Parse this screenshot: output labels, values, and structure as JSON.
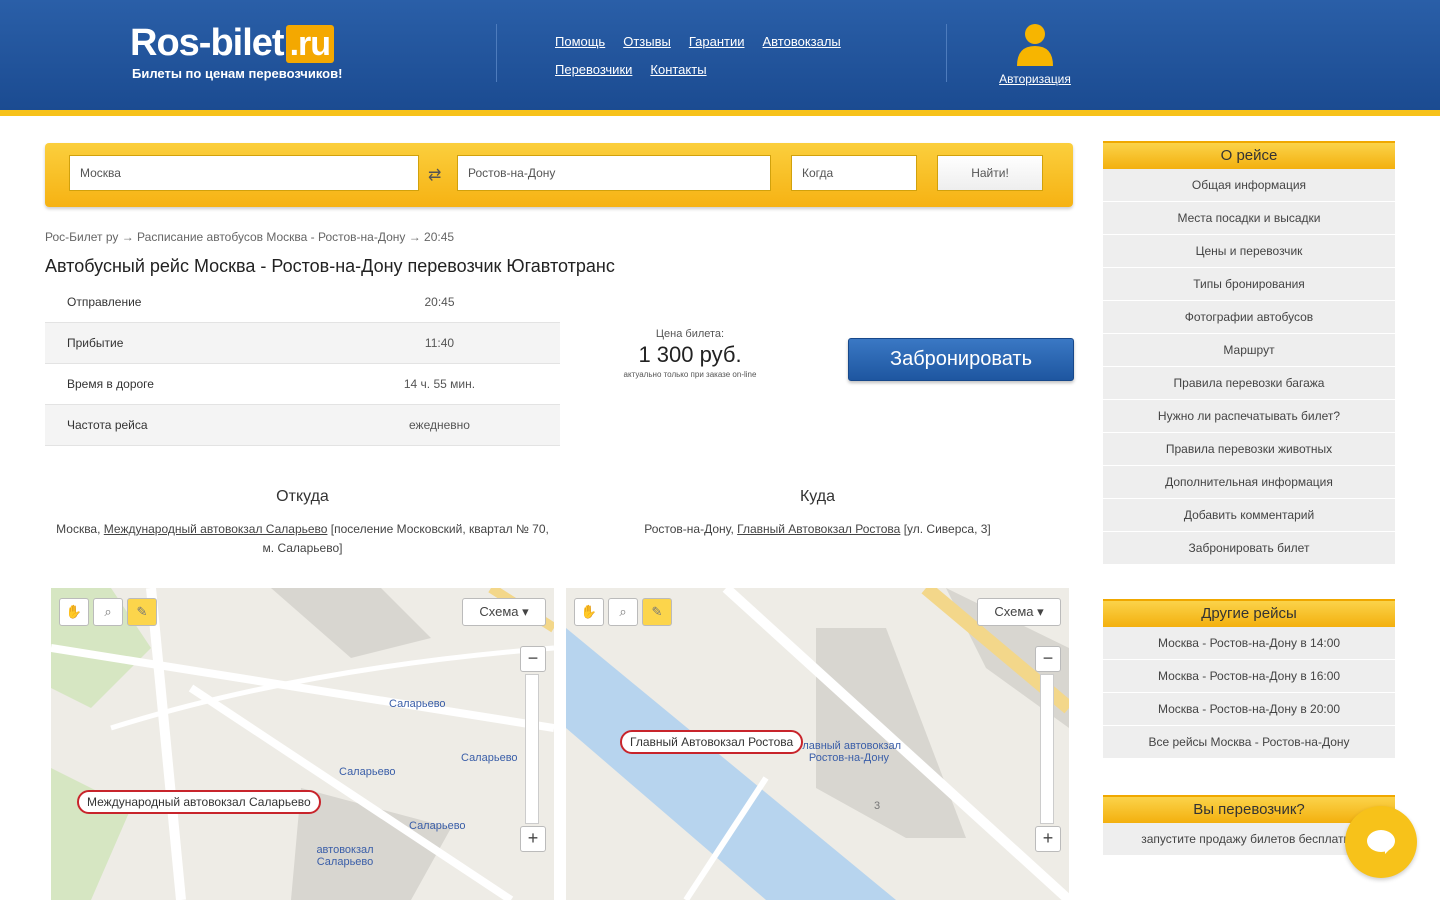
{
  "header": {
    "logo_main": "Ros-bilet",
    "logo_tld": ".ru",
    "tagline": "Билеты по ценам перевозчиков!",
    "nav": [
      "Помощь",
      "Отзывы",
      "Гарантии",
      "Автовокзалы",
      "Перевозчики",
      "Контакты"
    ],
    "auth_label": "Авторизация"
  },
  "search": {
    "from": "Москва",
    "to": "Ростов-на-Дону",
    "date_placeholder": "Когда",
    "submit": "Найти!",
    "swap_icon": "⇄"
  },
  "breadcrumb": "Рос-Билет ру → Расписание автобусов Москва - Ростов-на-Дону → 20:45",
  "title": "Автобусный рейс Москва - Ростов-на-Дону перевозчик Югавтотранс",
  "info_rows": [
    {
      "label": "Отправление",
      "value": "20:45"
    },
    {
      "label": "Прибытие",
      "value": "11:40"
    },
    {
      "label": "Время в дороге",
      "value": "14 ч. 55 мин."
    },
    {
      "label": "Частота рейса",
      "value": "ежедневно"
    }
  ],
  "price": {
    "label": "Цена билета:",
    "value": "1 300 руб.",
    "note": "актуально только при заказе on-line"
  },
  "book_button": "Забронировать",
  "from_block": {
    "heading": "Откуда",
    "prefix": "Москва, ",
    "link": "Международный автовокзал Саларьево",
    "suffix": " [поселение Московский, квартал № 70, м. Саларьево]"
  },
  "to_block": {
    "heading": "Куда",
    "prefix": "Ростов-на-Дону, ",
    "link": "Главный Автовокзал Ростова",
    "suffix": " [ул. Сиверса, 3]"
  },
  "map_left": {
    "layer": "Схема ▾",
    "callout": "Международный автовокзал Саларьево",
    "labels": [
      "Саларьево",
      "Саларьево",
      "Саларьево",
      "Саларьево",
      "автовокзал Саларьево"
    ]
  },
  "map_right": {
    "layer": "Схема ▾",
    "callout": "Главный Автовокзал Ростова",
    "labels": [
      "Главный автовокзал Ростов-на-Дону",
      "3"
    ]
  },
  "sidebar": {
    "about": {
      "heading": "О рейсе",
      "items": [
        "Общая информация",
        "Места посадки и высадки",
        "Цены и перевозчик",
        "Типы бронирования",
        "Фотографии автобусов",
        "Маршрут",
        "Правила перевозки багажа",
        "Нужно ли распечатывать билет?",
        "Правила перевозки животных",
        "Дополнительная информация",
        "Добавить комментарий",
        "Забронировать билет"
      ]
    },
    "other": {
      "heading": "Другие рейсы",
      "items": [
        "Москва - Ростов-на-Дону в 14:00",
        "Москва - Ростов-на-Дону в 16:00",
        "Москва - Ростов-на-Дону в 20:00",
        "Все рейсы Москва - Ростов-на-Дону"
      ]
    },
    "carrier": {
      "heading": "Вы перевозчик?",
      "items": [
        "запустите продажу билетов бесплатно"
      ]
    }
  },
  "colors": {
    "header_blue": "#1b4b91",
    "accent_yellow": "#f7c21a",
    "button_blue": "#1e56a0"
  }
}
